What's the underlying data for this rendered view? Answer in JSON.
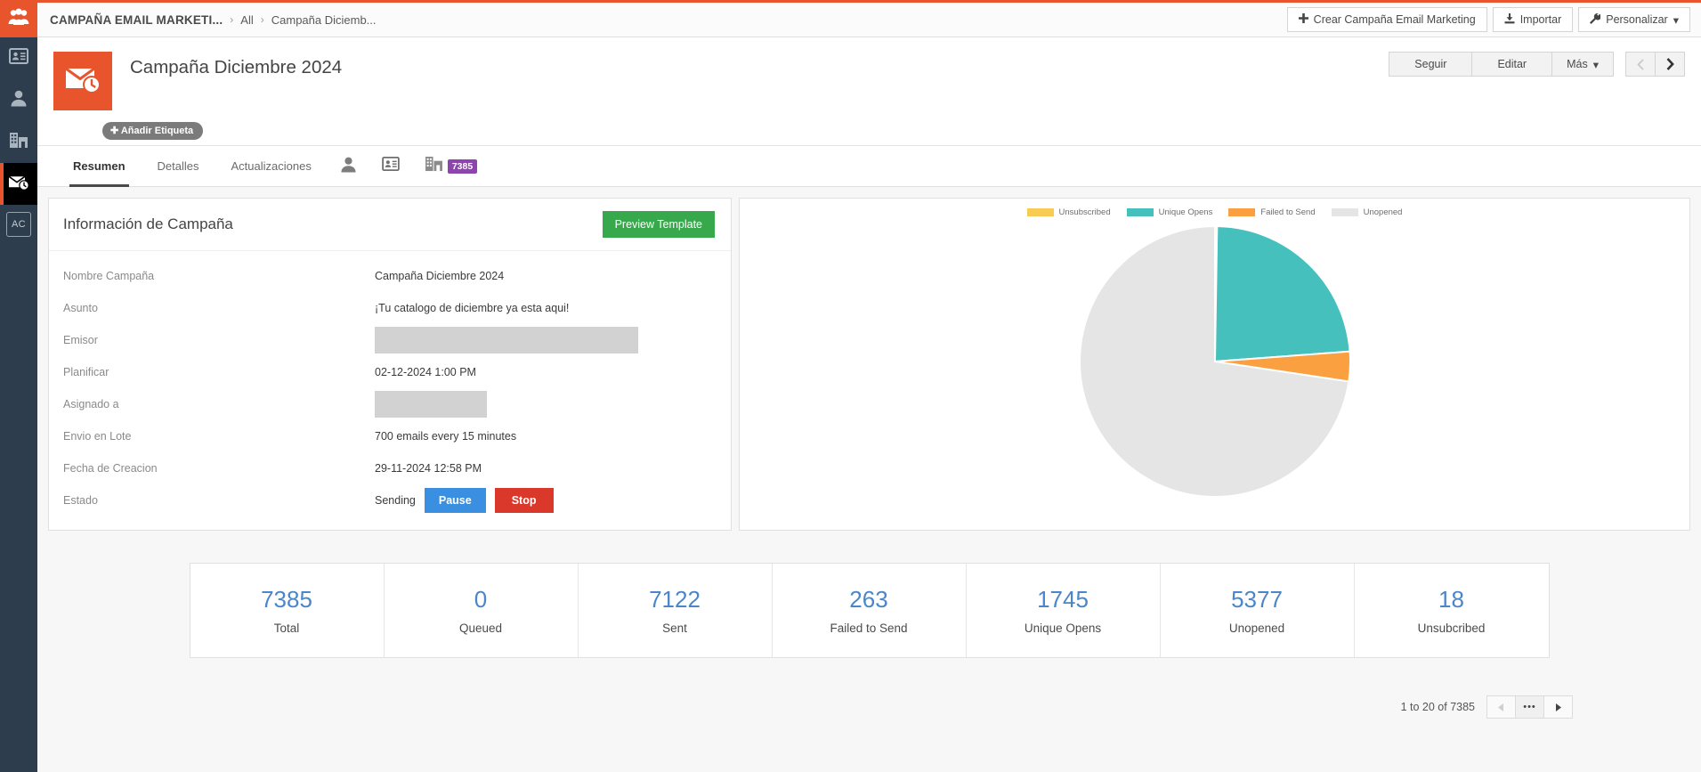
{
  "sidebar": {
    "logo_icon": "people-group-icon",
    "items": [
      {
        "icon": "contact-card-icon",
        "name": "contacts",
        "active": false
      },
      {
        "icon": "person-icon",
        "name": "leads",
        "active": false
      },
      {
        "icon": "building-icon",
        "name": "accounts",
        "active": false
      },
      {
        "icon": "email-clock-icon",
        "name": "email-campaigns",
        "active": true
      }
    ],
    "avatar_initials": "AC"
  },
  "topbar": {
    "module_title": "CAMPAÑA EMAIL MARKETI...",
    "breadcrumb": [
      "All",
      "Campaña Diciemb..."
    ],
    "separator": "›",
    "actions": [
      {
        "label": "Crear Campaña Email Marketing",
        "icon": "plus-icon"
      },
      {
        "label": "Importar",
        "icon": "import-icon"
      },
      {
        "label": "Personalizar",
        "icon": "wrench-icon",
        "caret": "▾"
      }
    ]
  },
  "record": {
    "icon": "email-clock-icon",
    "title": "Campaña Diciembre 2024",
    "tag_label": "✚ Añadir Etiqueta",
    "actions": [
      "Seguir",
      "Editar"
    ],
    "more_label": "Más",
    "more_caret": "▾",
    "prev_icon": "chevron-left-icon",
    "next_icon": "chevron-right-icon"
  },
  "tabs": {
    "items": [
      {
        "label": "Resumen",
        "active": true
      },
      {
        "label": "Detalles",
        "active": false
      },
      {
        "label": "Actualizaciones",
        "active": false
      }
    ],
    "icons": [
      {
        "name": "person-icon",
        "badge": ""
      },
      {
        "name": "contact-card-icon",
        "badge": ""
      },
      {
        "name": "building-icon",
        "badge": "7385"
      }
    ],
    "badge_color": "#8e44ad"
  },
  "info_panel": {
    "title": "Información de Campaña",
    "preview_button": "Preview Template",
    "fields": [
      {
        "label": "Nombre Campaña",
        "value": "Campaña Diciembre 2024",
        "type": "text"
      },
      {
        "label": "Asunto",
        "value": "¡Tu catalogo de diciembre ya esta aqui!",
        "type": "text"
      },
      {
        "label": "Emisor",
        "value": "",
        "type": "redacted-wide"
      },
      {
        "label": "Planificar",
        "value": "02-12-2024 1:00 PM",
        "type": "text"
      },
      {
        "label": "Asignado a",
        "value": "",
        "type": "redacted-narrow"
      },
      {
        "label": "Envio en Lote",
        "value": "700 emails every 15 minutes",
        "type": "text"
      },
      {
        "label": "Fecha de Creacion",
        "value": "29-11-2024 12:58 PM",
        "type": "text"
      },
      {
        "label": "Estado",
        "value": "Sending",
        "type": "status"
      }
    ],
    "pause_button": "Pause",
    "stop_button": "Stop"
  },
  "chart_data": {
    "type": "pie",
    "title": "",
    "legend_position": "top",
    "categories": [
      "Unsubscribed",
      "Unique Opens",
      "Failed to Send",
      "Unopened"
    ],
    "values": [
      18,
      1745,
      263,
      5377
    ],
    "colors": [
      "#f8cb55",
      "#45c0bc",
      "#faa040",
      "#e5e5e5"
    ],
    "total": 7403,
    "start_angle": 0
  },
  "stats": {
    "items": [
      {
        "value": "7385",
        "label": "Total"
      },
      {
        "value": "0",
        "label": "Queued"
      },
      {
        "value": "7122",
        "label": "Sent"
      },
      {
        "value": "263",
        "label": "Failed to Send"
      },
      {
        "value": "1745",
        "label": "Unique Opens"
      },
      {
        "value": "5377",
        "label": "Unopened"
      },
      {
        "value": "18",
        "label": "Unsubcribed"
      }
    ],
    "value_color": "#4a86c8"
  },
  "pagination": {
    "range_text": "1 to 20 of 7385",
    "prev_icon": "triangle-left-icon",
    "dots": "•••",
    "next_icon": "triangle-right-icon"
  }
}
